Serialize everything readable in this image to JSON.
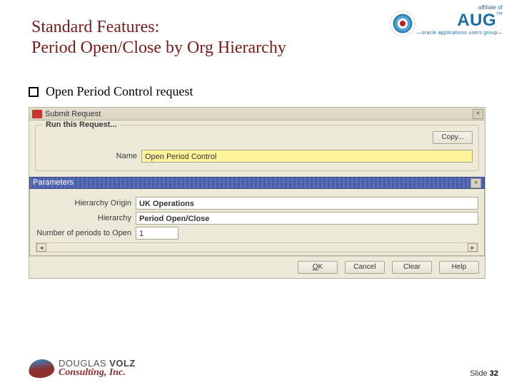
{
  "header": {
    "affiliate_of": "affiliate of",
    "org_name": "AUG",
    "tm": "™",
    "tagline": "—oracle applications users group—"
  },
  "title_line1": "Standard Features:",
  "title_line2": "Period Open/Close by Org Hierarchy",
  "bullet_text": "Open Period Control request",
  "screenshot": {
    "window_title": "Submit Request",
    "group_legend": "Run this Request...",
    "copy_label": "Copy...",
    "name_label": "Name",
    "name_value": "Open Period Control",
    "params_title": "Parameters",
    "fields": {
      "hierarchy_origin_label": "Hierarchy Origin",
      "hierarchy_origin_value": "UK Operations",
      "hierarchy_label": "Hierarchy",
      "hierarchy_value": "Period Open/Close",
      "num_periods_label": "Number of periods to Open",
      "num_periods_value": "1"
    },
    "buttons": {
      "ok": "OK",
      "cancel": "Cancel",
      "clear": "Clear",
      "help": "Help"
    }
  },
  "footer": {
    "dv_line1_a": "DOUGLAS ",
    "dv_line1_b": "VOLZ",
    "dv_line2": "Consulting, Inc.",
    "slide_label": "Slide ",
    "slide_number": "32"
  }
}
